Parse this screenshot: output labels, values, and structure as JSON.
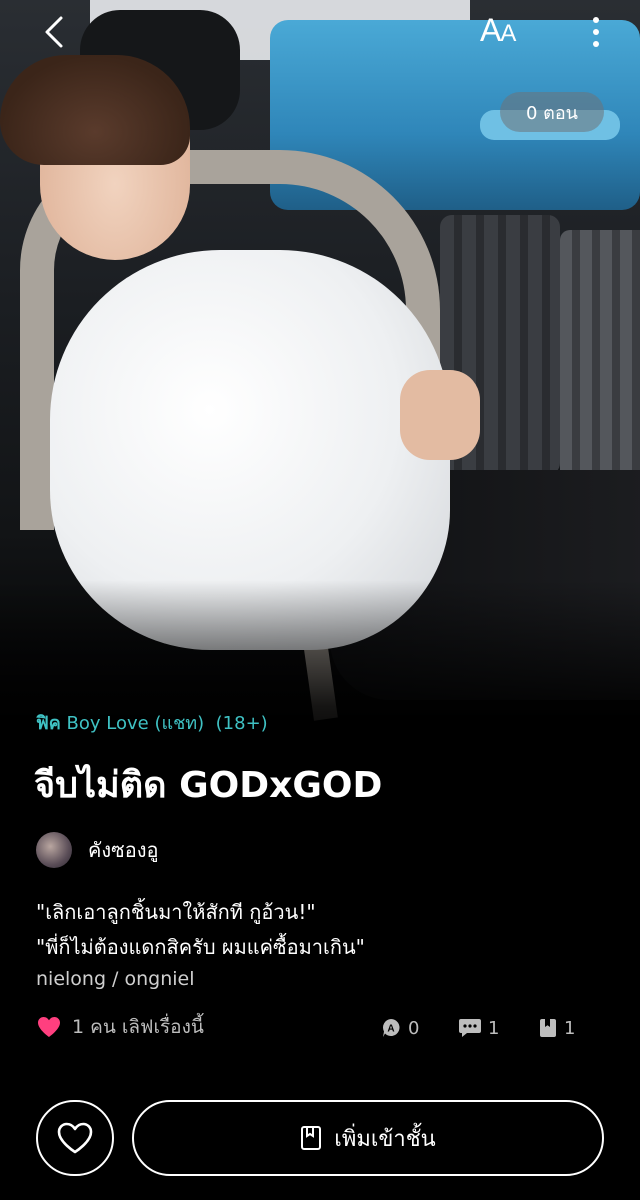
{
  "header": {
    "font_size_label_big": "A",
    "font_size_label_small": "A",
    "episodes": "0 ตอน"
  },
  "story": {
    "genre_prefix": "ฟิค",
    "genre_name": "Boy Love",
    "genre_type": "(แชท)",
    "rating": "(18+)",
    "title": "จีบไม่ติด  GODxGOD",
    "author": "คังซองอู",
    "quote_line1": "\"เลิกเอาลูกชิ้นมาให้สักที กูอ้วน!\"",
    "quote_line2": "\"พี่ก็ไม่ต้องแดกสิครับ ผมแค่ซื้อมาเกิน\"",
    "tags": "nielong / ongniel"
  },
  "stats": {
    "love_text": "1 คน เลิฟเรื่องนี้",
    "reviews": "0",
    "comments": "1",
    "bookmarks": "1"
  },
  "actions": {
    "add_to_shelf": "เพิ่มเข้าชั้น"
  },
  "colors": {
    "accent": "#3fc2c4",
    "heart": "#ff3f7f"
  }
}
